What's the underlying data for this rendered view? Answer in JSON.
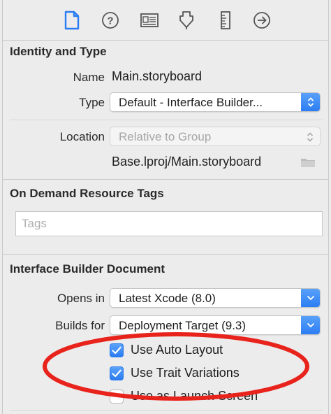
{
  "toolbar": {
    "icons": [
      "file-inspector-icon",
      "quick-help-icon",
      "identity-inspector-icon",
      "attributes-inspector-icon",
      "size-inspector-icon",
      "connections-inspector-icon"
    ],
    "accent": "#2b7cf3"
  },
  "identity": {
    "title": "Identity and Type",
    "name_label": "Name",
    "name_value": "Main.storyboard",
    "type_label": "Type",
    "type_value": "Default - Interface Builder...",
    "location_label": "Location",
    "location_value": "Relative to Group",
    "full_path": "Base.lproj/Main.storyboard"
  },
  "odr": {
    "title": "On Demand Resource Tags",
    "tags_placeholder": "Tags",
    "tags_value": ""
  },
  "ibdoc": {
    "title": "Interface Builder Document",
    "opens_in_label": "Opens in",
    "opens_in_value": "Latest Xcode (8.0)",
    "builds_for_label": "Builds for",
    "builds_for_value": "Deployment Target (9.3)",
    "use_auto_layout": "Use Auto Layout",
    "use_trait_variations": "Use Trait Variations",
    "use_as_launch_screen": "Use as Launch Screen",
    "use_auto_layout_checked": true,
    "use_trait_variations_checked": true,
    "use_as_launch_screen_checked": false
  },
  "annotation_color": "#e8231c"
}
